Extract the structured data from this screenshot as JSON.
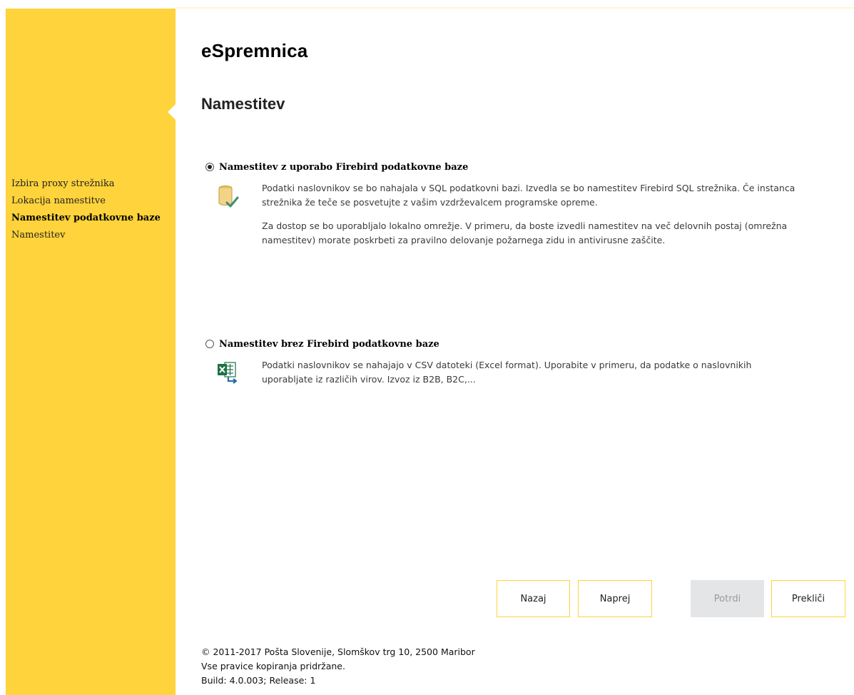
{
  "app": {
    "title": "eSpremnica"
  },
  "page": {
    "heading": "Namestitev"
  },
  "theme": {
    "accent": "#fed33b",
    "disabled_button_bg": "#e4e5e7"
  },
  "sidebar": {
    "items": [
      {
        "label": "Izbira proxy strežnika",
        "active": false
      },
      {
        "label": "Lokacija namestitve",
        "active": false
      },
      {
        "label": "Namestitev podatkovne baze",
        "active": true
      },
      {
        "label": "Namestitev",
        "active": false
      }
    ]
  },
  "options": [
    {
      "label": "Namestitev z uporabo Firebird podatkovne baze",
      "selected": true,
      "icon": "database-check-icon",
      "paragraphs": [
        "Podatki naslovnikov se bo nahajala v SQL podatkovni bazi. Izvedla se bo namestitev Firebird SQL strežnika. Če instanca strežnika že teče se posvetujte z vašim vzdrževalcem programske opreme.",
        "Za dostop se bo uporabljalo lokalno omrežje. V primeru, da boste izvedli namestitev na več delovnih postaj (omrežna namestitev) morate poskrbeti za pravilno delovanje požarnega zidu in antivirusne zaščite."
      ]
    },
    {
      "label": "Namestitev brez Firebird podatkovne baze",
      "selected": false,
      "icon": "excel-export-icon",
      "paragraphs": [
        "Podatki naslovnikov se nahajajo v CSV datoteki (Excel format). Uporabite v primeru, da podatke o naslovnikih uporabljate iz različih virov. Izvoz iz B2B, B2C,..."
      ]
    }
  ],
  "buttons": {
    "back": {
      "label": "Nazaj",
      "enabled": true
    },
    "next": {
      "label": "Naprej",
      "enabled": true
    },
    "confirm": {
      "label": "Potrdi",
      "enabled": false
    },
    "cancel": {
      "label": "Prekliči",
      "enabled": true
    }
  },
  "footer": {
    "copyright": "© 2011-2017 Pošta Slovenije, Slomškov trg 10, 2500 Maribor",
    "rights": "Vse pravice kopiranja pridržane.",
    "build": "Build: 4.0.003; Release: 1"
  }
}
